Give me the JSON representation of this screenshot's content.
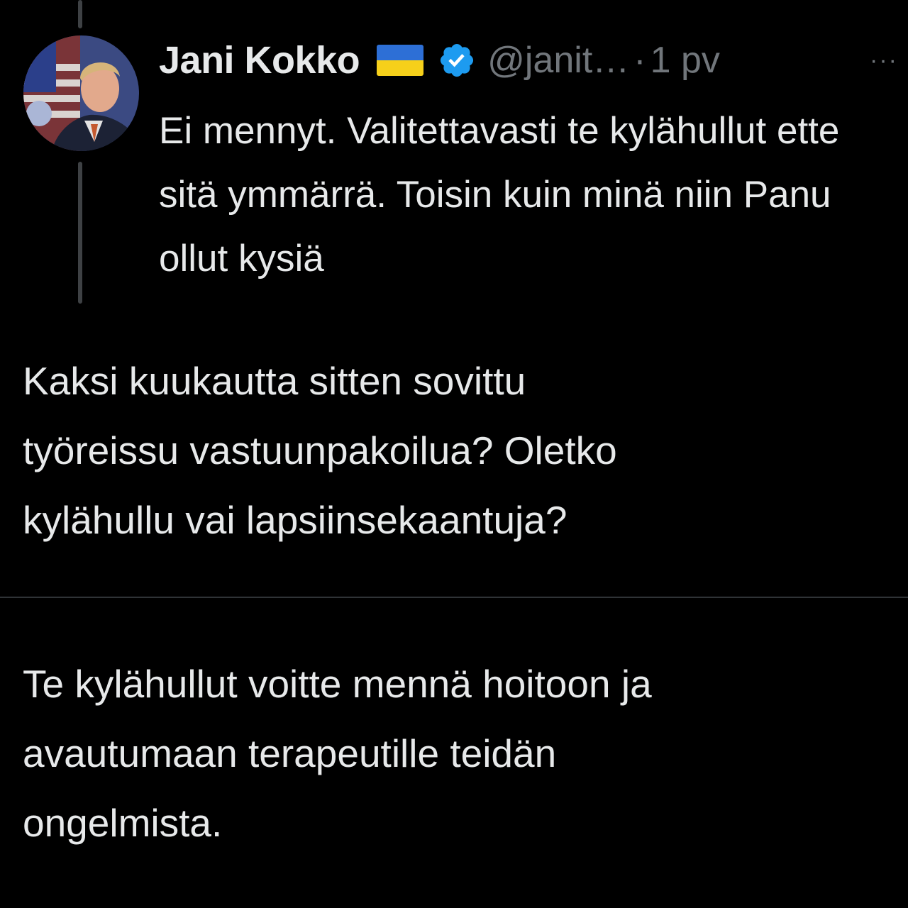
{
  "tweet": {
    "display_name": "Jani Kokko",
    "handle": "@janit…",
    "separator": "·",
    "time": "1 pv",
    "more_icon": "···",
    "text": "Ei mennyt. Valitettavasti te kylähullut ette sitä ymmärrä. Toisin kuin minä niin Panu ollut kysiä",
    "flag_colors": {
      "top": "#2d6fd6",
      "bottom": "#f6d01a"
    },
    "verified_color": "#1d9bf0"
  },
  "messages": [
    {
      "text": "Kaksi kuukautta sitten sovittu\ntyöreissu vastuunpakoilua? Oletko\nkylähullu vai lapsiinsekaantuja?"
    },
    {
      "text": "Te kylähullut voitte mennä hoitoon ja\navautumaan terapeutille teidän\nongelmista."
    }
  ],
  "colors": {
    "background": "#000000",
    "text": "#e7e9ea",
    "secondary_text": "#71767b",
    "divider": "#2f3336"
  }
}
